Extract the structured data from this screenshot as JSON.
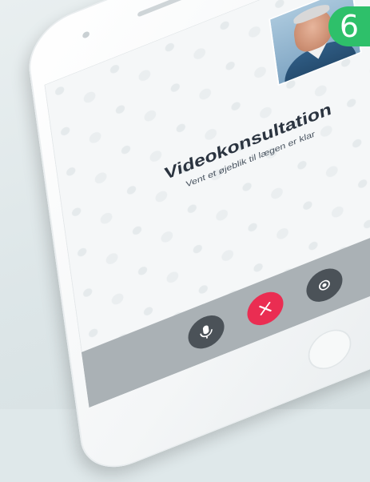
{
  "badge": {
    "step_number": "6"
  },
  "screen": {
    "title": "Videokonsultation",
    "subtitle": "Vent et øjeblik til lægen er klar"
  },
  "controls": {
    "mic_icon": "microphone-icon",
    "end_icon": "close-icon",
    "settings_icon": "camera-switch-icon"
  },
  "colors": {
    "badge": "#2ec06a",
    "end_call": "#ea2d52",
    "control_bg": "#4b5258",
    "call_bar": "#aab1b5"
  }
}
